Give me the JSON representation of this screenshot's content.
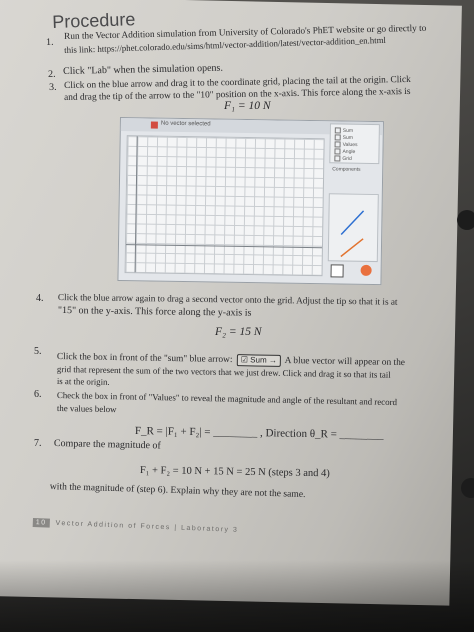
{
  "heading": "Procedure",
  "steps": {
    "s1_a": "Run the Vector Addition simulation from University of Colorado's PhET website or go directly to",
    "s1_b": "this link: https://phet.colorado.edu/sims/html/vector-addition/latest/vector-addition_en.html",
    "s2": "Click \"Lab\" when the simulation opens.",
    "s3_a": "Click on the blue arrow and drag it to the coordinate grid, placing the tail at the origin. Click",
    "s3_b": "and drag the tip of the arrow to the \"10\" position on the x-axis. This force along the x-axis is",
    "f1": "F₁ = 10 N",
    "s4_a": "Click the blue arrow again to drag a second vector onto the grid. Adjust the tip so that it is at",
    "s4_b": "\"15\" on the y-axis. This force along the y-axis is",
    "f2": "F₂ = 15 N",
    "s5_a": "Click the box in front of the \"sum\" blue arrow:",
    "s5_sum_label": "Sum",
    "s5_b": "A blue vector will appear on the",
    "s5_c": "grid that represent the sum of the two vectors that we just drew. Click and drag it so that its tail",
    "s5_d": "is at the origin.",
    "s6_a": "Check the box in front of \"Values\" to reveal the magnitude and angle of the resultant and record",
    "s6_b": "the values below",
    "fr": "F_R = |F₁ + F₂| = ________ , Direction θ_R = ________",
    "s7": "Compare the magnitude of",
    "sum_eq": "F₁ + F₂ = 10 N + 15 N = 25 N (steps 3 and 4)",
    "s7_b": "with the magnitude of (step 6). Explain why they are not the same."
  },
  "numbers": {
    "n1": "1.",
    "n2": "2.",
    "n3": "3.",
    "n4": "4.",
    "n5": "5.",
    "n6": "6.",
    "n7": "7."
  },
  "sim": {
    "bar_text": "No vector selected",
    "options": [
      "Sum",
      "Sum",
      "Values",
      "Angle",
      "Grid"
    ],
    "components_label": "Components"
  },
  "footer": {
    "page": "10",
    "text": "Vector Addition of Forces | Laboratory 3"
  }
}
